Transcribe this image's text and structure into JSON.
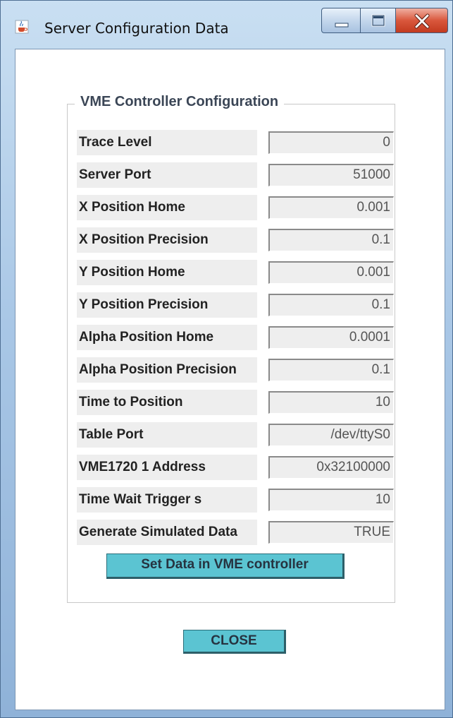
{
  "window": {
    "title": "Server Configuration Data",
    "icon": "java-coffee-cup-icon",
    "colors": {
      "frame": "#a9c7e6",
      "close_button": "#d9573c",
      "action_button": "#5bc4d2",
      "field_background": "#eeeeee"
    }
  },
  "group": {
    "title": "VME Controller Configuration"
  },
  "rows": [
    {
      "label": "Trace Level",
      "value": "0"
    },
    {
      "label": "Server Port",
      "value": "51000"
    },
    {
      "label": "X Position Home",
      "value": "0.001"
    },
    {
      "label": "X Position Precision",
      "value": "0.1"
    },
    {
      "label": "Y Position Home",
      "value": "0.001"
    },
    {
      "label": "Y Position Precision",
      "value": "0.1"
    },
    {
      "label": "Alpha Position Home",
      "value": "0.0001"
    },
    {
      "label": "Alpha Position Precision",
      "value": "0.1"
    },
    {
      "label": "Time to Position",
      "value": "10"
    },
    {
      "label": "Table Port",
      "value": "/dev/ttyS0"
    },
    {
      "label": "VME1720 1 Address",
      "value": "0x32100000"
    },
    {
      "label": "Time Wait Trigger s",
      "value": "10"
    },
    {
      "label": "Generate Simulated Data",
      "value": "TRUE"
    }
  ],
  "buttons": {
    "set_data_label": "Set Data in VME controller",
    "close_label": "CLOSE"
  }
}
